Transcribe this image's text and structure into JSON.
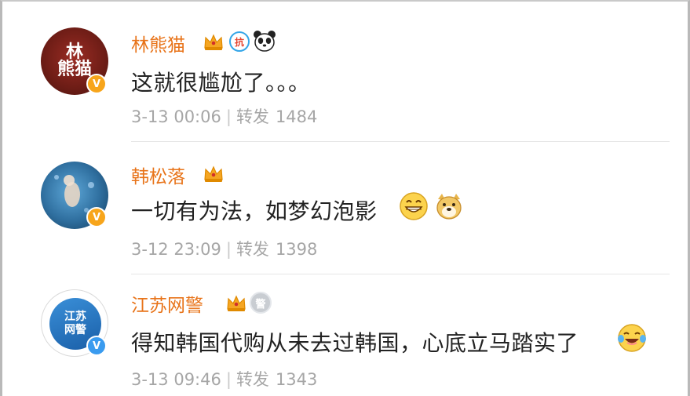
{
  "comments": [
    {
      "username": "林熊猫",
      "avatar_text": "林熊猫",
      "badge_anti": "抗",
      "text": "这就很尴尬了。。。",
      "date": "3-13 00:06",
      "repost_label": "转发",
      "repost_count": "1484",
      "verified": "V"
    },
    {
      "username": "韩松落",
      "text": "一切有为法，如梦幻泡影",
      "date": "3-12 23:09",
      "repost_label": "转发",
      "repost_count": "1398",
      "verified": "V"
    },
    {
      "username": "江苏网警",
      "avatar_text": "江苏网警",
      "badge_medal": "警",
      "text": "得知韩国代购从未去过韩国，心底立马踏实了",
      "date": "3-13 09:46",
      "repost_label": "转发",
      "repost_count": "1343",
      "verified": "V"
    }
  ],
  "colors": {
    "username": "#e8741a",
    "meta": "#a6a6a6",
    "verified_orange": "#f7a51b",
    "verified_blue": "#3a9bef"
  }
}
